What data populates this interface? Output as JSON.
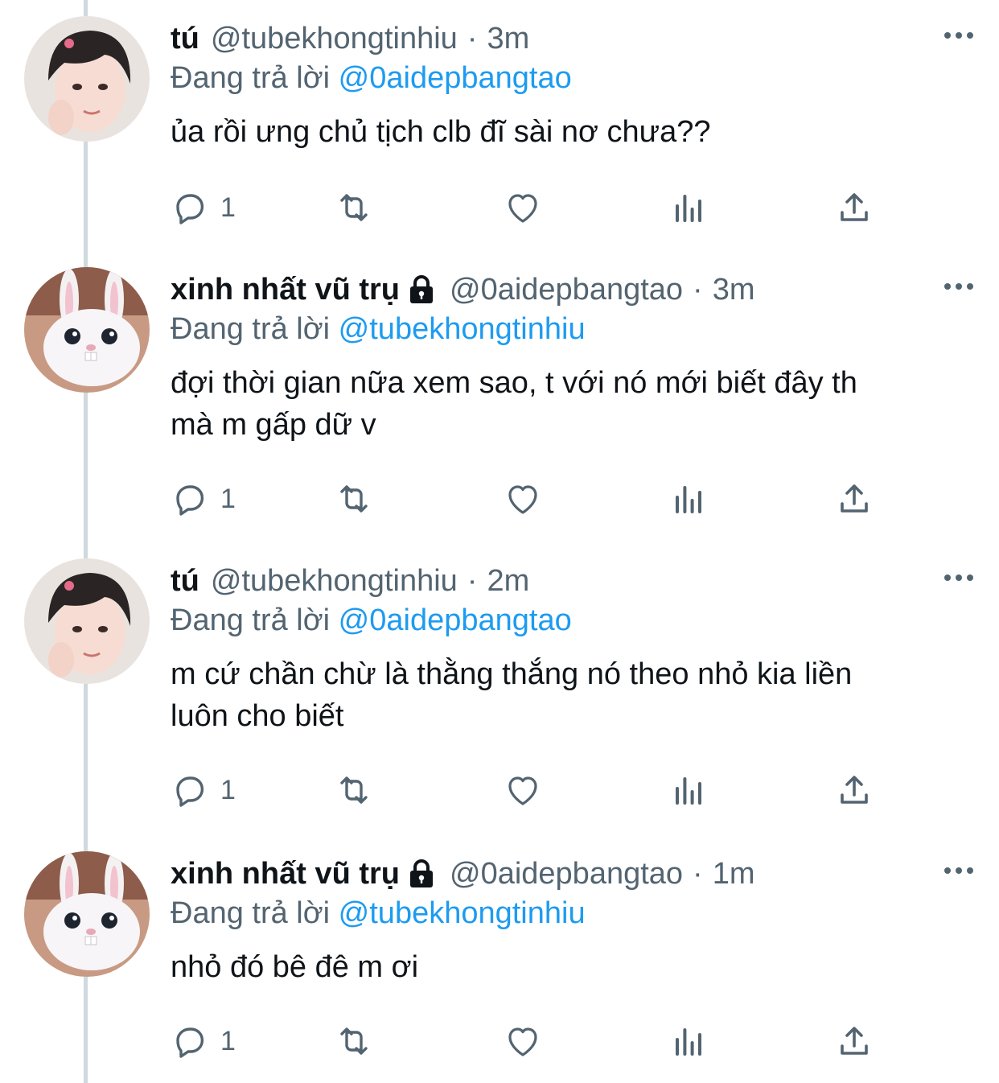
{
  "colors": {
    "link": "#1d9bf0",
    "muted": "#536471",
    "text": "#0f1419",
    "thread_line": "#cfd9de"
  },
  "tweets": [
    {
      "name": "tú",
      "protected": false,
      "handle": "@tubekhongtinhiu",
      "dot": "·",
      "time": "3m",
      "replying_prefix": "Đang trả lời",
      "replying_to": "@0aidepbangtao",
      "lines": [
        "ủa rồi ưng chủ tịch clb đĩ sài nơ chưa??"
      ],
      "reply_count": "1",
      "avatar": "person-portrait"
    },
    {
      "name": "xinh nhất vũ trụ",
      "protected": true,
      "handle": "@0aidepbangtao",
      "dot": "·",
      "time": "3m",
      "replying_prefix": "Đang trả lời",
      "replying_to": "@tubekhongtinhiu",
      "lines": [
        "đợi thời gian nữa xem sao, t với nó mới biết đây th",
        "mà m gấp dữ v"
      ],
      "reply_count": "1",
      "avatar": "white-bunny"
    },
    {
      "name": "tú",
      "protected": false,
      "handle": "@tubekhongtinhiu",
      "dot": "·",
      "time": "2m",
      "replying_prefix": "Đang trả lời",
      "replying_to": "@0aidepbangtao",
      "lines": [
        "m cứ chần chừ là thằng thắng nó theo nhỏ kia liền",
        "luôn cho biết"
      ],
      "reply_count": "1",
      "avatar": "person-portrait"
    },
    {
      "name": "xinh nhất vũ trụ",
      "protected": true,
      "handle": "@0aidepbangtao",
      "dot": "·",
      "time": "1m",
      "replying_prefix": "Đang trả lời",
      "replying_to": "@tubekhongtinhiu",
      "lines": [
        "nhỏ đó bê đê m ơi"
      ],
      "reply_count": "1",
      "avatar": "white-bunny"
    }
  ]
}
